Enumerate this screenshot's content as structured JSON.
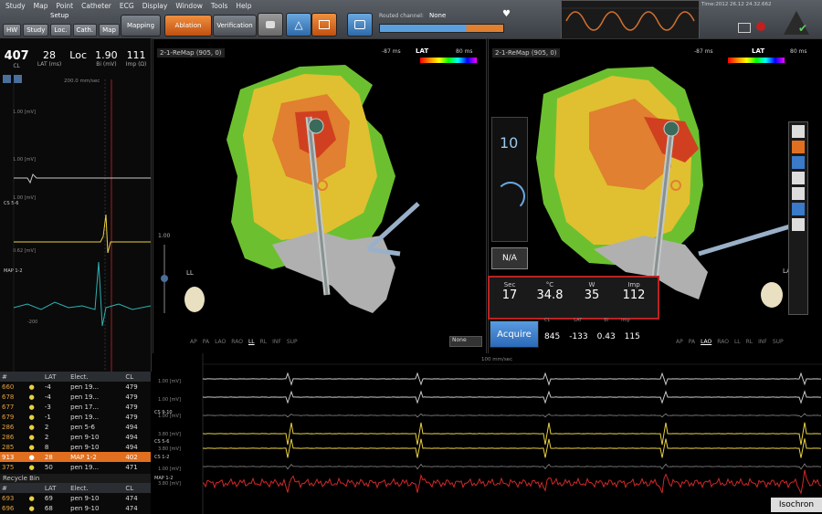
{
  "menu": [
    "Study",
    "Map",
    "Point",
    "Catheter",
    "ECG",
    "Display",
    "Window",
    "Tools",
    "Help"
  ],
  "toolbar": {
    "setup_label": "Setup",
    "tabs": [
      "HW",
      "Study",
      "Loc.",
      "Cath.",
      "Map"
    ],
    "mapping_label": "Mapping",
    "ablation_label": "Ablation",
    "verification_label": "Verification",
    "routed_channel_label": "Routed channel:",
    "routed_channel_value": "None",
    "status_text": "Time:2012 26.12 24.32.662"
  },
  "left_panel": {
    "values": [
      {
        "value": "407",
        "label": "CL"
      },
      {
        "value": "28",
        "label": "LAT (ms)"
      },
      {
        "value": "Loc",
        "label": ""
      },
      {
        "value": "1.90",
        "label": "Bi (mV)"
      },
      {
        "value": "111",
        "label": "Imp (Ω)"
      }
    ],
    "sweep_label": "200.0 mm/sec",
    "scale_labels": [
      "1.00 [mV]",
      "1.00 [mV]",
      "1.00 [mV]",
      "0.62 [mV]",
      "-200"
    ],
    "channel_labels": [
      "CS 5-6",
      "MAP 1-2"
    ]
  },
  "view_left": {
    "title": "2-1-ReMap (905, 0)",
    "lat_low": "-87 ms",
    "lat_label": "LAT",
    "lat_high": "80 ms",
    "orient_label": "LL",
    "scale_top": "1.00",
    "orients": [
      "AP",
      "PA",
      "LAO",
      "RAO",
      "LL",
      "RL",
      "INF",
      "SUP"
    ],
    "dropdown": "None"
  },
  "view_right": {
    "title": "2-1-ReMap (905, 0)",
    "lat_low": "-87 ms",
    "lat_label": "LAT",
    "lat_high": "80 ms",
    "orient_label": "LAO",
    "orients": [
      "AP",
      "PA",
      "LAO",
      "RAO",
      "LL",
      "RL",
      "INF",
      "SUP"
    ],
    "power_value": "10",
    "na_label": "N/A",
    "acquire_label": "Acquire"
  },
  "ablation": {
    "labels": [
      "Sec",
      "°C",
      "W",
      "Imp"
    ],
    "values": [
      "17",
      "34.8",
      "35",
      "112"
    ]
  },
  "acquire_stats": {
    "labels": [
      "CL",
      "LAT",
      "Bi",
      "Imp"
    ],
    "values": [
      "845",
      "-133",
      "0.43",
      "115"
    ]
  },
  "points_table": {
    "headers": [
      "#",
      "LAT",
      "Elect.",
      "CL"
    ],
    "rows": [
      [
        "660",
        "-4",
        "pen 19...",
        "479"
      ],
      [
        "678",
        "-4",
        "pen 19...",
        "479"
      ],
      [
        "677",
        "-3",
        "pen 17...",
        "479"
      ],
      [
        "679",
        "-1",
        "pen 19...",
        "479"
      ],
      [
        "286",
        "2",
        "pen 5-6",
        "494"
      ],
      [
        "286",
        "2",
        "pen 9-10",
        "494"
      ],
      [
        "285",
        "8",
        "pen 9-10",
        "494"
      ],
      [
        "913",
        "28",
        "MAP 1-2",
        "402"
      ],
      [
        "375",
        "50",
        "pen 19...",
        "471"
      ]
    ],
    "selected_index": 7,
    "recycle_label": "Recycle Bin",
    "recycle_rows": [
      [
        "693",
        "69",
        "pen 9-10",
        "474"
      ],
      [
        "696",
        "68",
        "pen 9-10",
        "474"
      ]
    ]
  },
  "ecg_panel": {
    "sweep_label": "100 mm/sec",
    "scale_labels": [
      "1.00 [mV]",
      "1.00 [mV]",
      "1.00 [mV]",
      "3.80 [mV]",
      "3.80 [mV]",
      "1.00 [mV]",
      "3.80 [mV]"
    ],
    "channel_labels": [
      "CS 9-10",
      "CS 5-6",
      "CS 1-2",
      "MAP 1-2"
    ],
    "isochronal_label": "Isochron"
  },
  "colors": {
    "accent": "#e07020",
    "alarm": "#b22222",
    "ecg_red": "#d02828",
    "ecg_yellow": "#e8d040"
  }
}
